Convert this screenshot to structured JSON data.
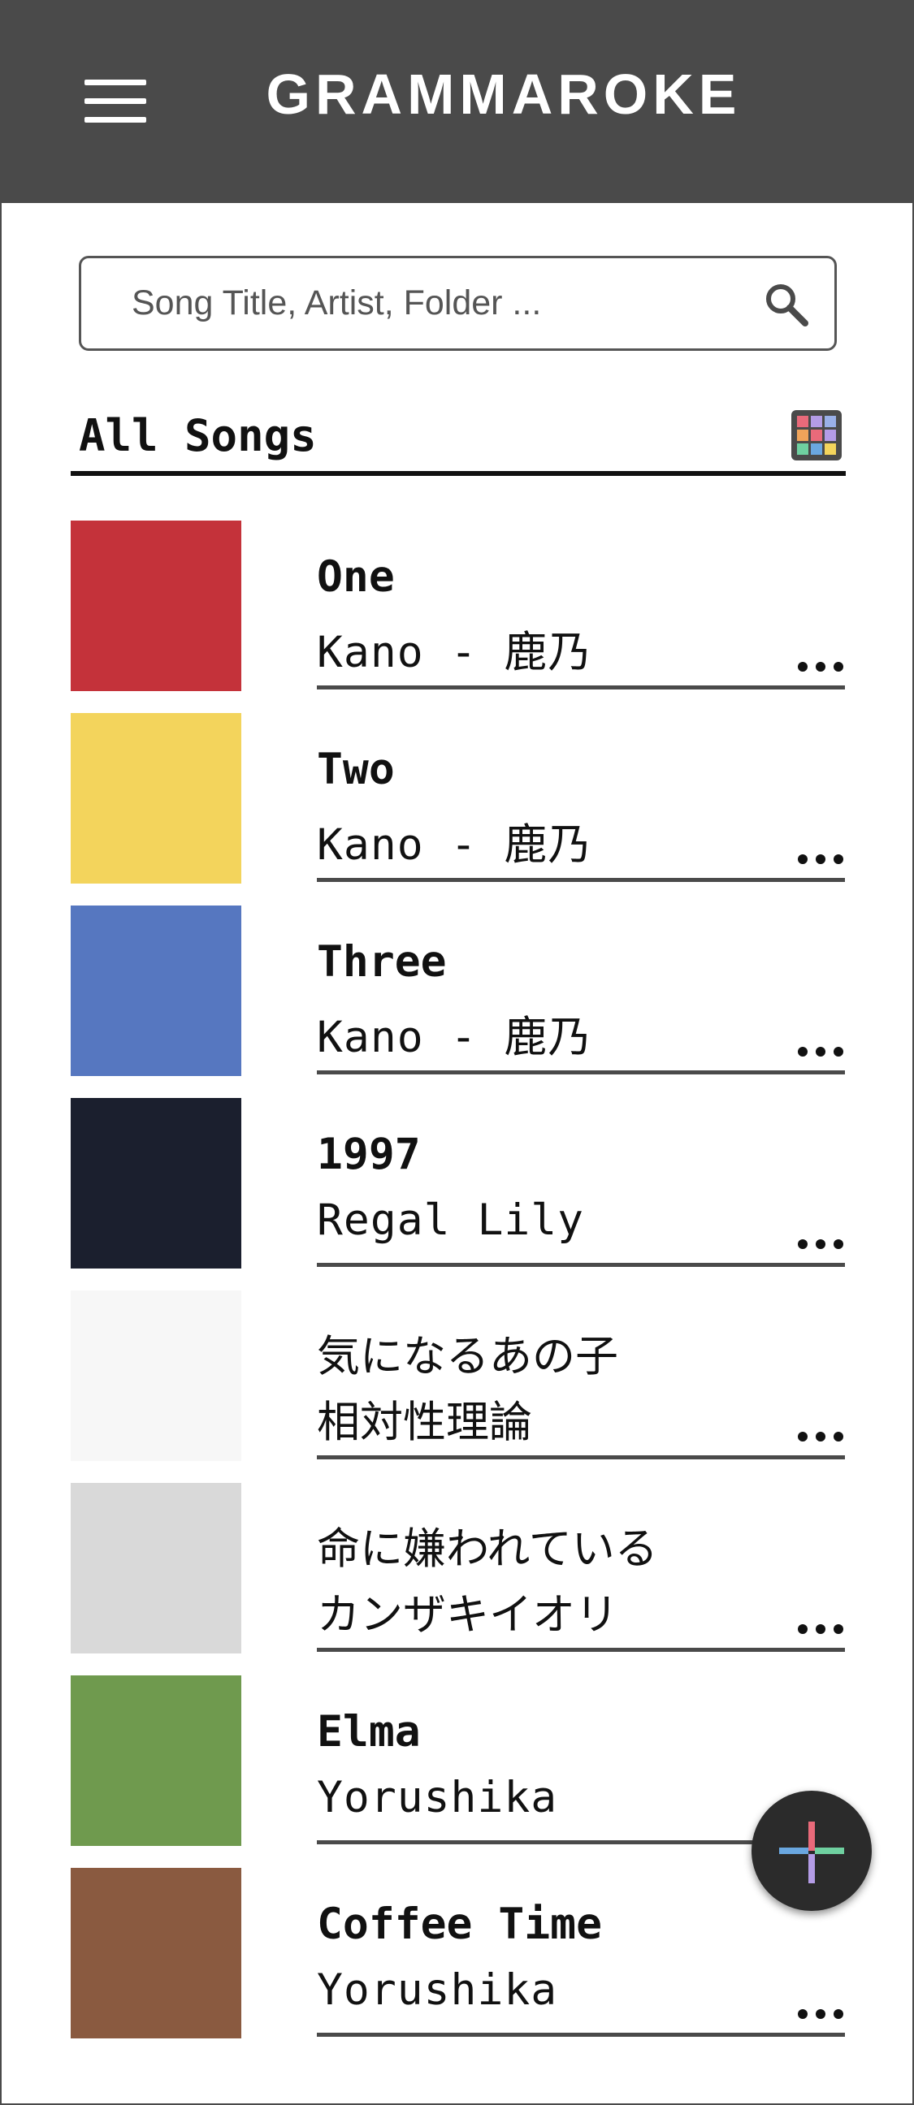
{
  "app": {
    "title": "GRAMMAROKE"
  },
  "icons": {
    "menu": "hamburger-menu-icon",
    "search": "search-icon",
    "grid": "grid-view-icon",
    "more": "more-horizontal-icon",
    "add": "add-plus-icon"
  },
  "search": {
    "placeholder": "Song Title, Artist, Folder ...",
    "value": ""
  },
  "section": {
    "title": "All Songs"
  },
  "colors": {
    "appbar": "#4a4a4a",
    "fab": "#2b2b2b",
    "fab_plus": [
      "#e96a7a",
      "#6fd0a0",
      "#6aa7e0",
      "#b49ce6"
    ]
  },
  "songs": [
    {
      "title": "One",
      "artist": "Kano - 鹿乃",
      "art_bg": "#c4323a"
    },
    {
      "title": "Two",
      "artist": "Kano - 鹿乃",
      "art_bg": "#f3d45c"
    },
    {
      "title": "Three",
      "artist": "Kano - 鹿乃",
      "art_bg": "#5677c0"
    },
    {
      "title": "1997",
      "artist": "Regal Lily",
      "art_bg": "#1b1f2e"
    },
    {
      "title": "気になるあの子",
      "artist": "相対性理論",
      "art_bg": "#f7f7f7"
    },
    {
      "title": "命に嫌われている",
      "artist": "カンザキイオリ",
      "art_bg": "#d9d9d9"
    },
    {
      "title": "Elma",
      "artist": "Yorushika",
      "art_bg": "#6f9a4e"
    },
    {
      "title": "Coffee Time",
      "artist": "Yorushika",
      "art_bg": "#8a5a40"
    }
  ]
}
